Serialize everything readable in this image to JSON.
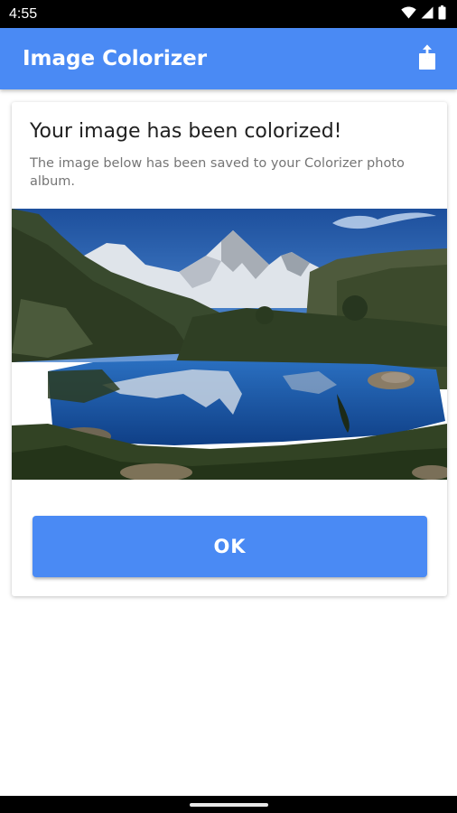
{
  "status_bar": {
    "time": "4:55",
    "icons": [
      "wifi-icon",
      "cellular-signal-icon",
      "battery-icon"
    ]
  },
  "app_bar": {
    "title": "Image Colorizer",
    "actions": [
      "share-icon"
    ],
    "color": "#4a8af4"
  },
  "dialog": {
    "title": "Your image has been colorized!",
    "message": "The image below has been saved to your Colorizer photo album.",
    "image_description_icon": "mountain-lake-photo",
    "ok_label": "OK",
    "button_color": "#4a8af4"
  },
  "nav_bar": {
    "gesture": "home-pill"
  }
}
